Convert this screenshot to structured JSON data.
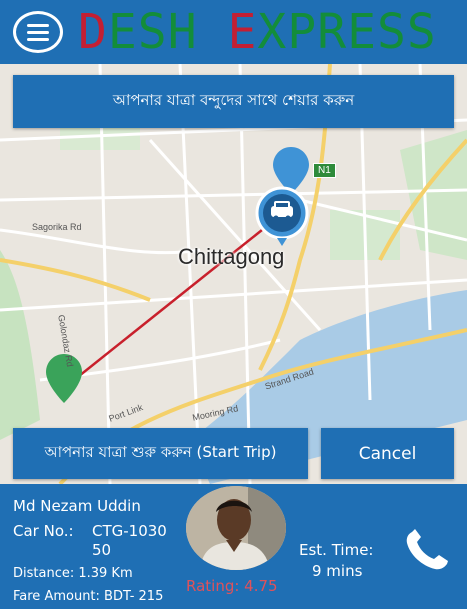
{
  "app": {
    "brand_initial_1": "D",
    "brand_part_1": "ESH ",
    "brand_initial_2": "E",
    "brand_part_2": "XPRESS"
  },
  "map": {
    "share_button_label": "আপনার যাত্রা বন্দুদের সাথে শেয়ার করুন",
    "city_label": "Chittagong",
    "road_labels": [
      "Sagorika Rd",
      "Golondaz Rd",
      "Strand Road",
      "Mooring Rd",
      "Port Link"
    ],
    "road_shield": "N1",
    "start_button_label": "আপনার যাত্রা শুরু করুন (Start Trip)",
    "cancel_button_label": "Cancel"
  },
  "trip": {
    "driver_name": "Md Nezam Uddin",
    "car_no_label": "Car No.:",
    "car_no_value": "CTG-1030 50",
    "distance": "Distance:  1.39 Km",
    "fare": "Fare Amount:  BDT- 215",
    "rating": "Rating: 4.75",
    "est_time_label": "Est. Time:",
    "est_time_value": "9 mins"
  },
  "colors": {
    "primary": "#1f6fb4",
    "brand_green": "#138d3a",
    "brand_red": "#c31f33",
    "route_line": "#c8202c",
    "pin_blue": "#3f93d6",
    "pin_green": "#3aa35a",
    "rating_text": "#e0525a"
  },
  "icons": {
    "menu": "hamburger-icon",
    "car": "car-icon",
    "destination": "map-pin-icon",
    "origin": "map-pin-icon",
    "call": "phone-icon"
  }
}
